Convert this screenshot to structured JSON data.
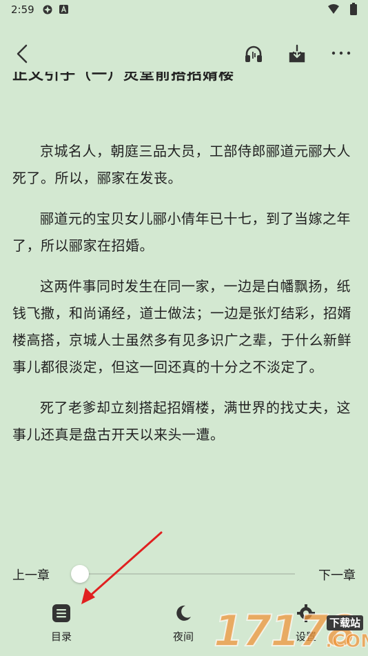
{
  "status_bar": {
    "time": "2:59",
    "icons": [
      "vpn-icon",
      "font-icon",
      "wifi-icon",
      "battery-icon"
    ]
  },
  "toolbar": {
    "icons": [
      "back-arrow-icon",
      "headphones-icon",
      "download-icon",
      "more-icon"
    ]
  },
  "content": {
    "chapter_title": "正文引子（一）灵堂前搭招婿楼",
    "paragraphs": [
      "京城名人，朝庭三品大员，工部侍郎郦道元郦大人死了。所以，郦家在发丧。",
      "郦道元的宝贝女儿郦小倩年已十七，到了当嫁之年了，所以郦家在招婚。",
      "这两件事同时发生在同一家，一边是白幡飘扬，纸钱飞撒，和尚诵经，道士做法；一边是张灯结彩，招婿楼高搭，京城人士虽然多有见多识广之辈，于什么新鲜事儿都很淡定，但这一回还真的十分之不淡定了。",
      "死了老爹却立刻搭起招婿楼，满世界的找丈夫，这事儿还真是盘古开天以来头一遭。"
    ]
  },
  "chapter_nav": {
    "prev_label": "上一章",
    "next_label": "下一章",
    "progress": 0
  },
  "bottom_nav": {
    "toc_label": "目录",
    "night_label": "夜间",
    "settings_label": "设置"
  },
  "watermark": {
    "digits": "17178",
    "badge": "下载站",
    "suffix": ".COM"
  },
  "colors": {
    "background": "#d3e8d1",
    "text": "#222222",
    "annotation": "#e02020"
  }
}
